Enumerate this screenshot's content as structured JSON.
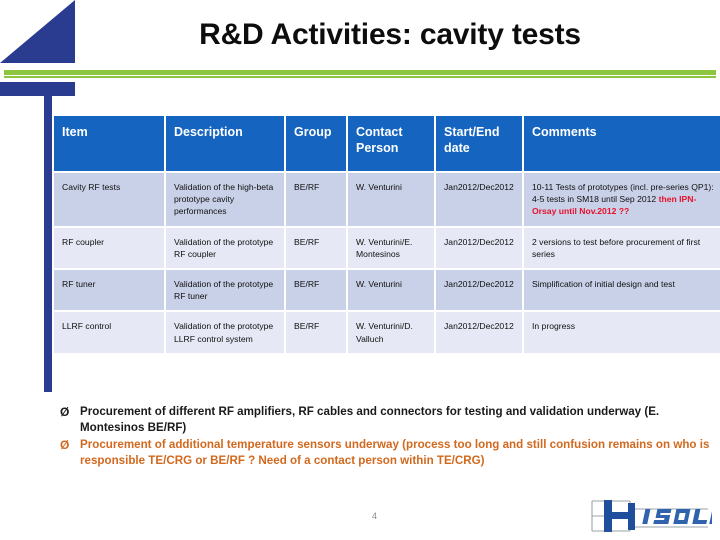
{
  "slide": {
    "title": "R&D Activities: cavity tests",
    "page_number": "4",
    "accent_blue": "#2a3c8f",
    "accent_green": "#8cc63e",
    "header_blue": "#1565c0",
    "row_a_bg": "#c9d1e8",
    "row_b_bg": "#e6e9f5",
    "red_text": "#e8102a",
    "orange_text": "#d2691e"
  },
  "table": {
    "headers": [
      "Item",
      "Description",
      "Group",
      "Contact Person",
      "Start/End date",
      "Comments"
    ],
    "rows": [
      {
        "item": "Cavity RF tests",
        "description": "Validation of the high-beta prototype cavity performances",
        "group": "BE/RF",
        "contact": "W. Venturini",
        "dates": "Jan2012/Dec2012",
        "comments_plain": "10-11 Tests of prototypes (incl. pre-series QP1): 4-5 tests in SM18 until Sep 2012 ",
        "comments_red": "then IPN-Orsay until Nov.2012 ??"
      },
      {
        "item": "RF coupler",
        "description": "Validation of the prototype RF coupler",
        "group": "BE/RF",
        "contact": "W. Venturini/E. Montesinos",
        "dates": "Jan2012/Dec2012",
        "comments_plain": "2 versions to test before procurement of first series",
        "comments_red": ""
      },
      {
        "item": "RF tuner",
        "description": "Validation of the prototype RF tuner",
        "group": "BE/RF",
        "contact": "W. Venturini",
        "dates": "Jan2012/Dec2012",
        "comments_plain": "Simplification of initial design and test",
        "comments_red": ""
      },
      {
        "item": "LLRF control",
        "description": "Validation of the prototype LLRF control system",
        "group": "BE/RF",
        "contact": "W. Venturini/D. Valluch",
        "dates": "Jan2012/Dec2012",
        "comments_plain": "In progress",
        "comments_red": ""
      }
    ]
  },
  "bullets": [
    {
      "marker": "Ø",
      "text": "Procurement of different RF amplifiers, RF cables and connectors for testing and validation underway (E. Montesinos BE/RF)",
      "style": "dark"
    },
    {
      "marker": "Ø",
      "text": "Procurement of additional temperature sensors underway (process too long and still confusion remains on who is responsible TE/CRG or BE/RF ? Need of a contact person within TE/CRG)",
      "style": "orange"
    }
  ],
  "logo": {
    "name": "hie-isolde-logo",
    "text": "ISOLDE"
  }
}
